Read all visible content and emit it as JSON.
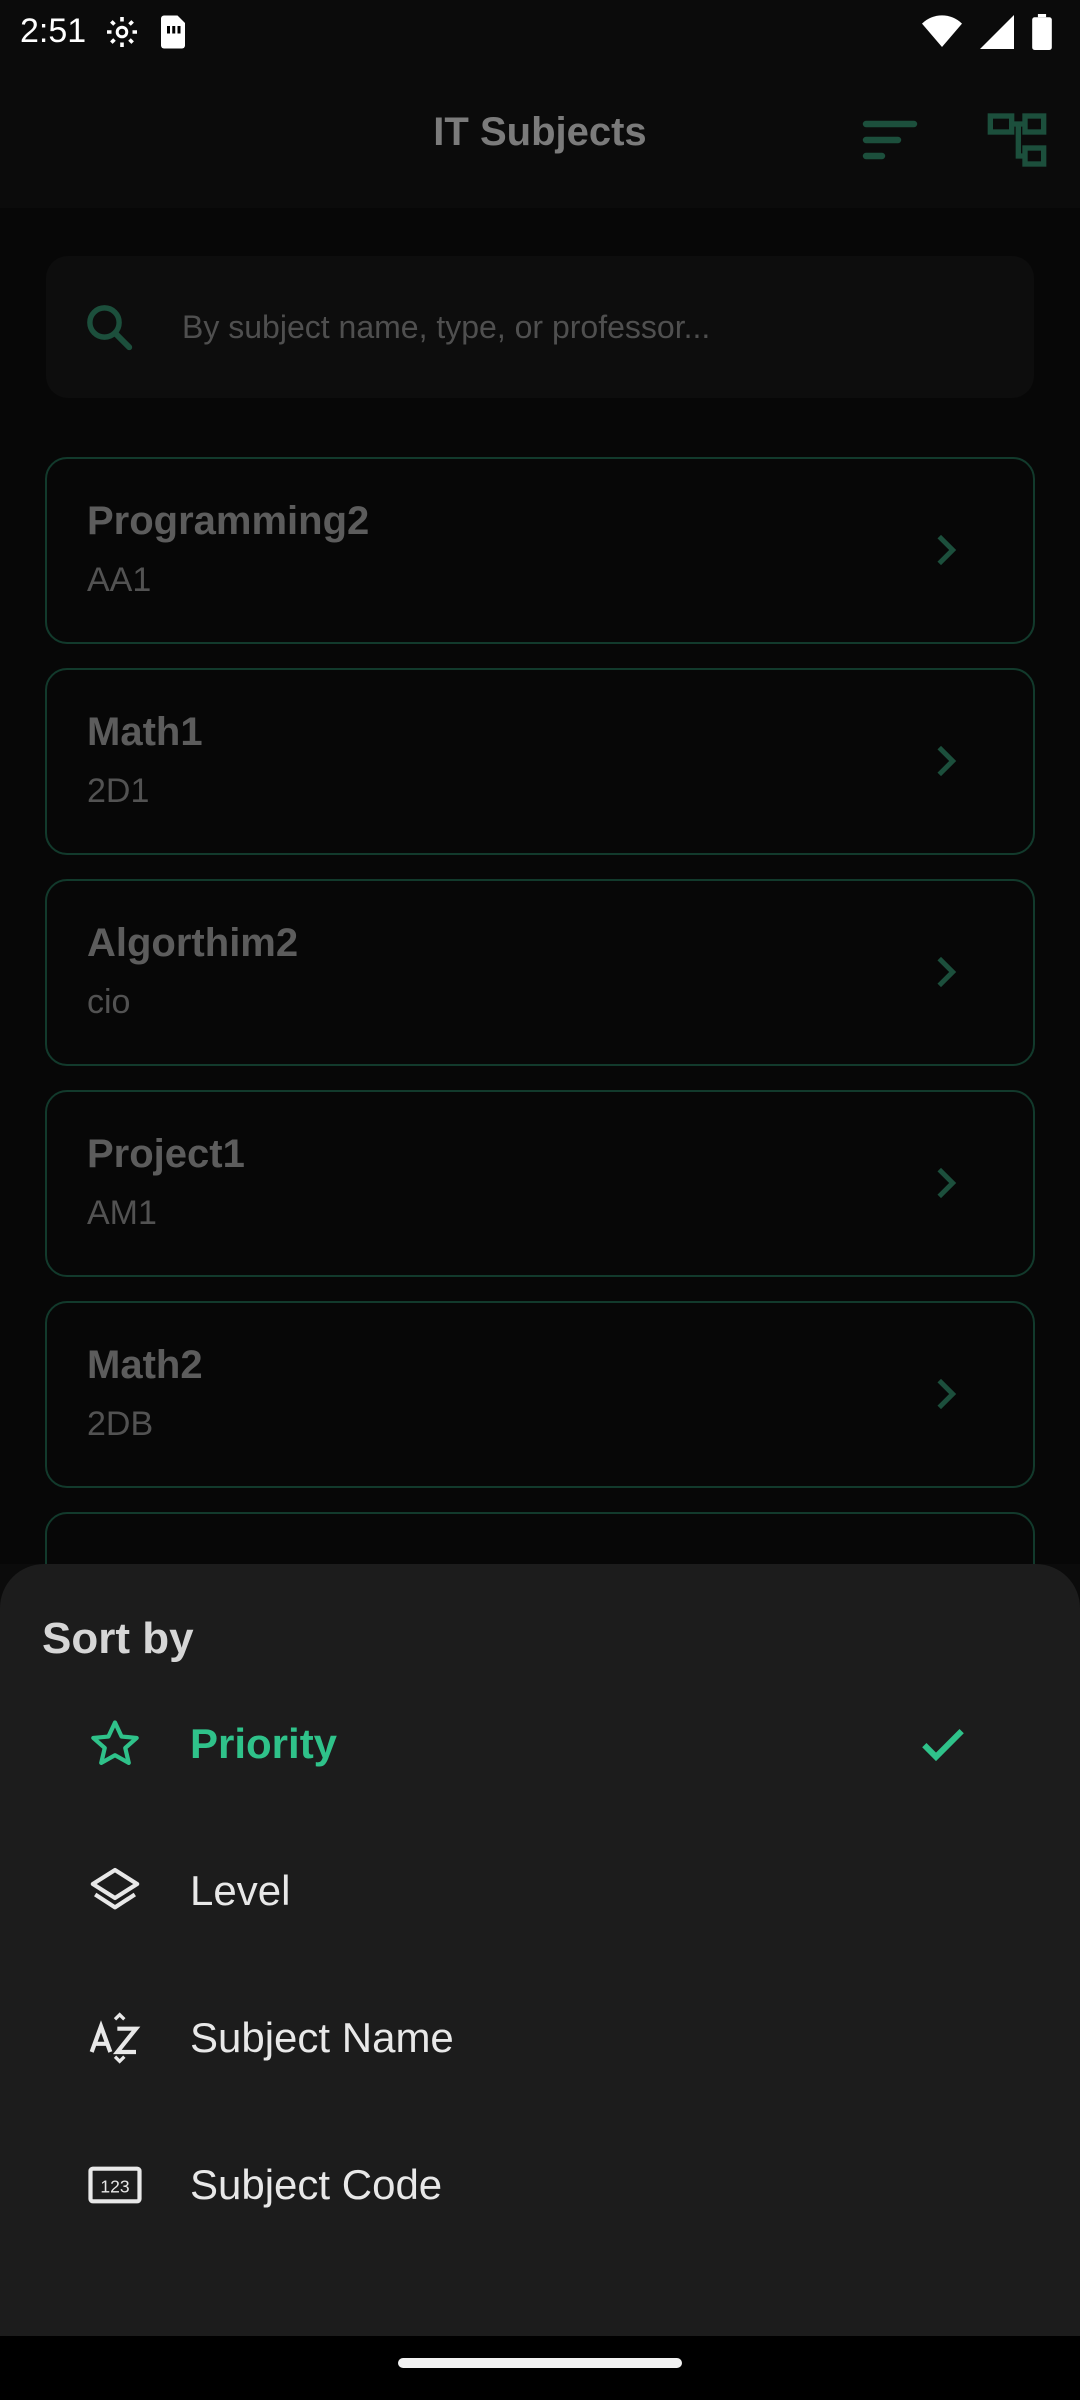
{
  "status_bar": {
    "time": "2:51",
    "left_icons": [
      "settings-icon",
      "sim-card-icon"
    ],
    "right_icons": [
      "wifi-icon",
      "cellular-signal-icon",
      "battery-icon"
    ]
  },
  "app_bar": {
    "title": "IT Subjects",
    "actions": [
      "sort-icon",
      "hierarchy-icon"
    ]
  },
  "search": {
    "placeholder": "By subject name, type, or professor..."
  },
  "subjects": [
    {
      "name": "Programming2",
      "code": "AA1"
    },
    {
      "name": "Math1",
      "code": "2D1"
    },
    {
      "name": "Algorthim2",
      "code": "cio"
    },
    {
      "name": "Project1",
      "code": "AM1"
    },
    {
      "name": "Math2",
      "code": "2DB"
    }
  ],
  "sort_sheet": {
    "title": "Sort by",
    "options": [
      {
        "label": "Priority",
        "icon": "star-icon",
        "selected": true
      },
      {
        "label": "Level",
        "icon": "layers-icon",
        "selected": false
      },
      {
        "label": "Subject Name",
        "icon": "sort-alpha-icon",
        "selected": false
      },
      {
        "label": "Subject Code",
        "icon": "numbers-icon",
        "selected": false
      }
    ]
  },
  "colors": {
    "accent": "#2fc28a",
    "card_border": "#1d5a44",
    "background": "#0b0b0b",
    "sheet_background": "#1c1c1c"
  }
}
